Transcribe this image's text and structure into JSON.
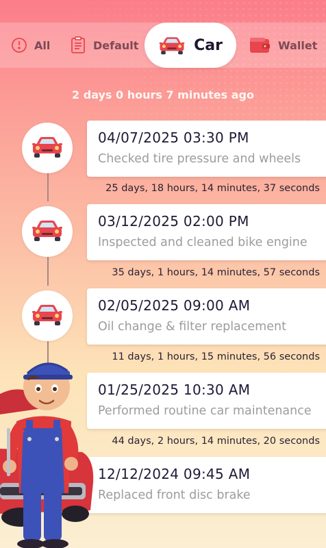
{
  "tabs": [
    {
      "label": "All",
      "icon": "clock-icon"
    },
    {
      "label": "Default",
      "icon": "clipboard-icon"
    },
    {
      "label": "Car",
      "icon": "car-icon",
      "active": true
    },
    {
      "label": "Wallet",
      "icon": "wallet-icon"
    }
  ],
  "last_service_ago": "2 days 0 hours 7 minutes ago",
  "entries": [
    {
      "datetime": "04/07/2025 03:30 PM",
      "description": "Checked tire pressure and wheels",
      "icon": "car-icon"
    },
    {
      "datetime": "03/12/2025 02:00 PM",
      "description": "Inspected and cleaned bike engine",
      "icon": "car-icon"
    },
    {
      "datetime": "02/05/2025 09:00 AM",
      "description": "Oil change & filter replacement",
      "icon": "car-icon"
    },
    {
      "datetime": "01/25/2025 10:30 AM",
      "description": "Performed routine car maintenance",
      "icon": "car-icon"
    },
    {
      "datetime": "12/12/2024 09:45 AM",
      "description": "Replaced front disc brake",
      "icon": "car-icon"
    }
  ],
  "intervals": [
    "25 days, 18 hours, 14 minutes, 37 seconds",
    "35 days, 1 hours, 14 minutes, 57 seconds",
    "11 days, 1 hours, 15 minutes, 56 seconds",
    "44 days, 2 hours, 14 minutes, 20 seconds"
  ],
  "colors": {
    "accent_red": "#e8454e",
    "text_dark": "#1d1a36",
    "text_muted": "#9c9c9c",
    "tab_text": "#7c4a54"
  }
}
